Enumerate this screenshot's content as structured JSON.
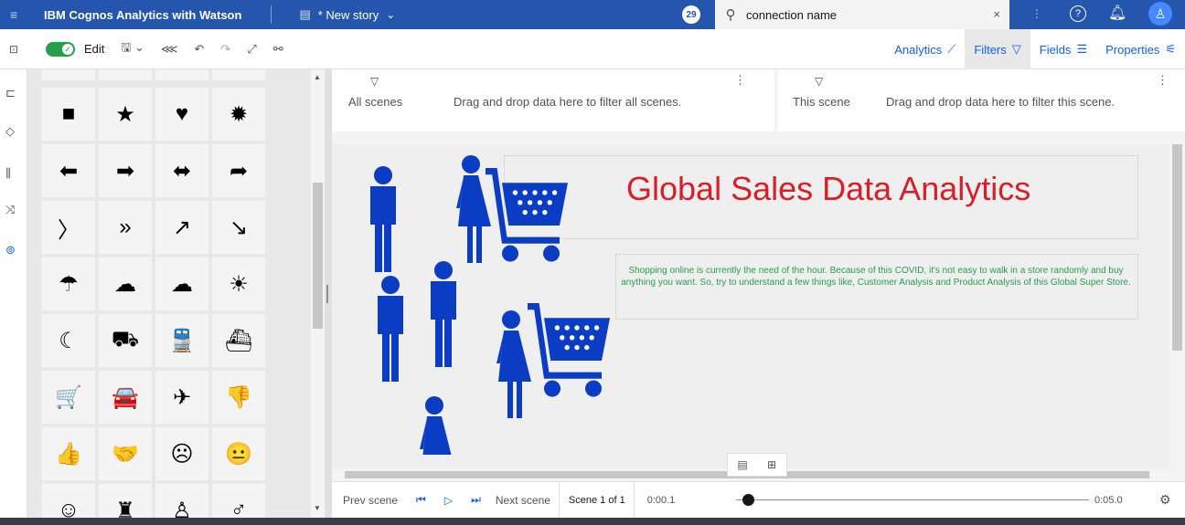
{
  "topbar": {
    "app_name": "IBM Cognos Analytics with Watson",
    "story_title": "* New story",
    "badge": "29",
    "search_value": "connection name",
    "clear_symbol": "×",
    "help_symbol": "?"
  },
  "toolbar": {
    "edit_label": "Edit",
    "analytics_label": "Analytics",
    "filters_label": "Filters",
    "fields_label": "Fields",
    "properties_label": "Properties"
  },
  "shapes_panel": {
    "symbols": [
      [
        "■",
        "★",
        "♥",
        "✹"
      ],
      [
        "⬅",
        "➡",
        "⬌",
        "➦"
      ],
      [
        "〉",
        "»",
        "↗",
        "↘"
      ],
      [
        "☂",
        "☁",
        "☁",
        "☀"
      ],
      [
        "☾",
        "⛟",
        "🚆",
        "⛴"
      ],
      [
        "🛒",
        "🚘",
        "✈",
        "👎"
      ],
      [
        "👍",
        "🤝",
        "☹",
        "😐"
      ],
      [
        "☺",
        "♜",
        "♙",
        "♂"
      ]
    ]
  },
  "filters": {
    "all_scenes_label": "All scenes",
    "all_scenes_hint": "Drag and drop data here to filter all scenes.",
    "this_scene_label": "This scene",
    "this_scene_hint": "Drag and drop data here to filter this scene."
  },
  "canvas": {
    "title": "Global Sales Data Analytics",
    "description": "Shopping online is currently the need of the hour. Because of this COVID, it's not easy to walk in a store randomly and buy anything you want. So, try to understand a few things like, Customer Analysis and Product Analysis of this Global Super Store.",
    "people_color": "#0a3dc4",
    "title_color": "#da1e28",
    "description_color": "#24a148"
  },
  "playback": {
    "prev_scene": "Prev scene",
    "next_scene": "Next scene",
    "scene_counter": "Scene 1 of 1",
    "time_current": "0:00.1",
    "time_total": "0:05.0",
    "progress": 0.02
  }
}
